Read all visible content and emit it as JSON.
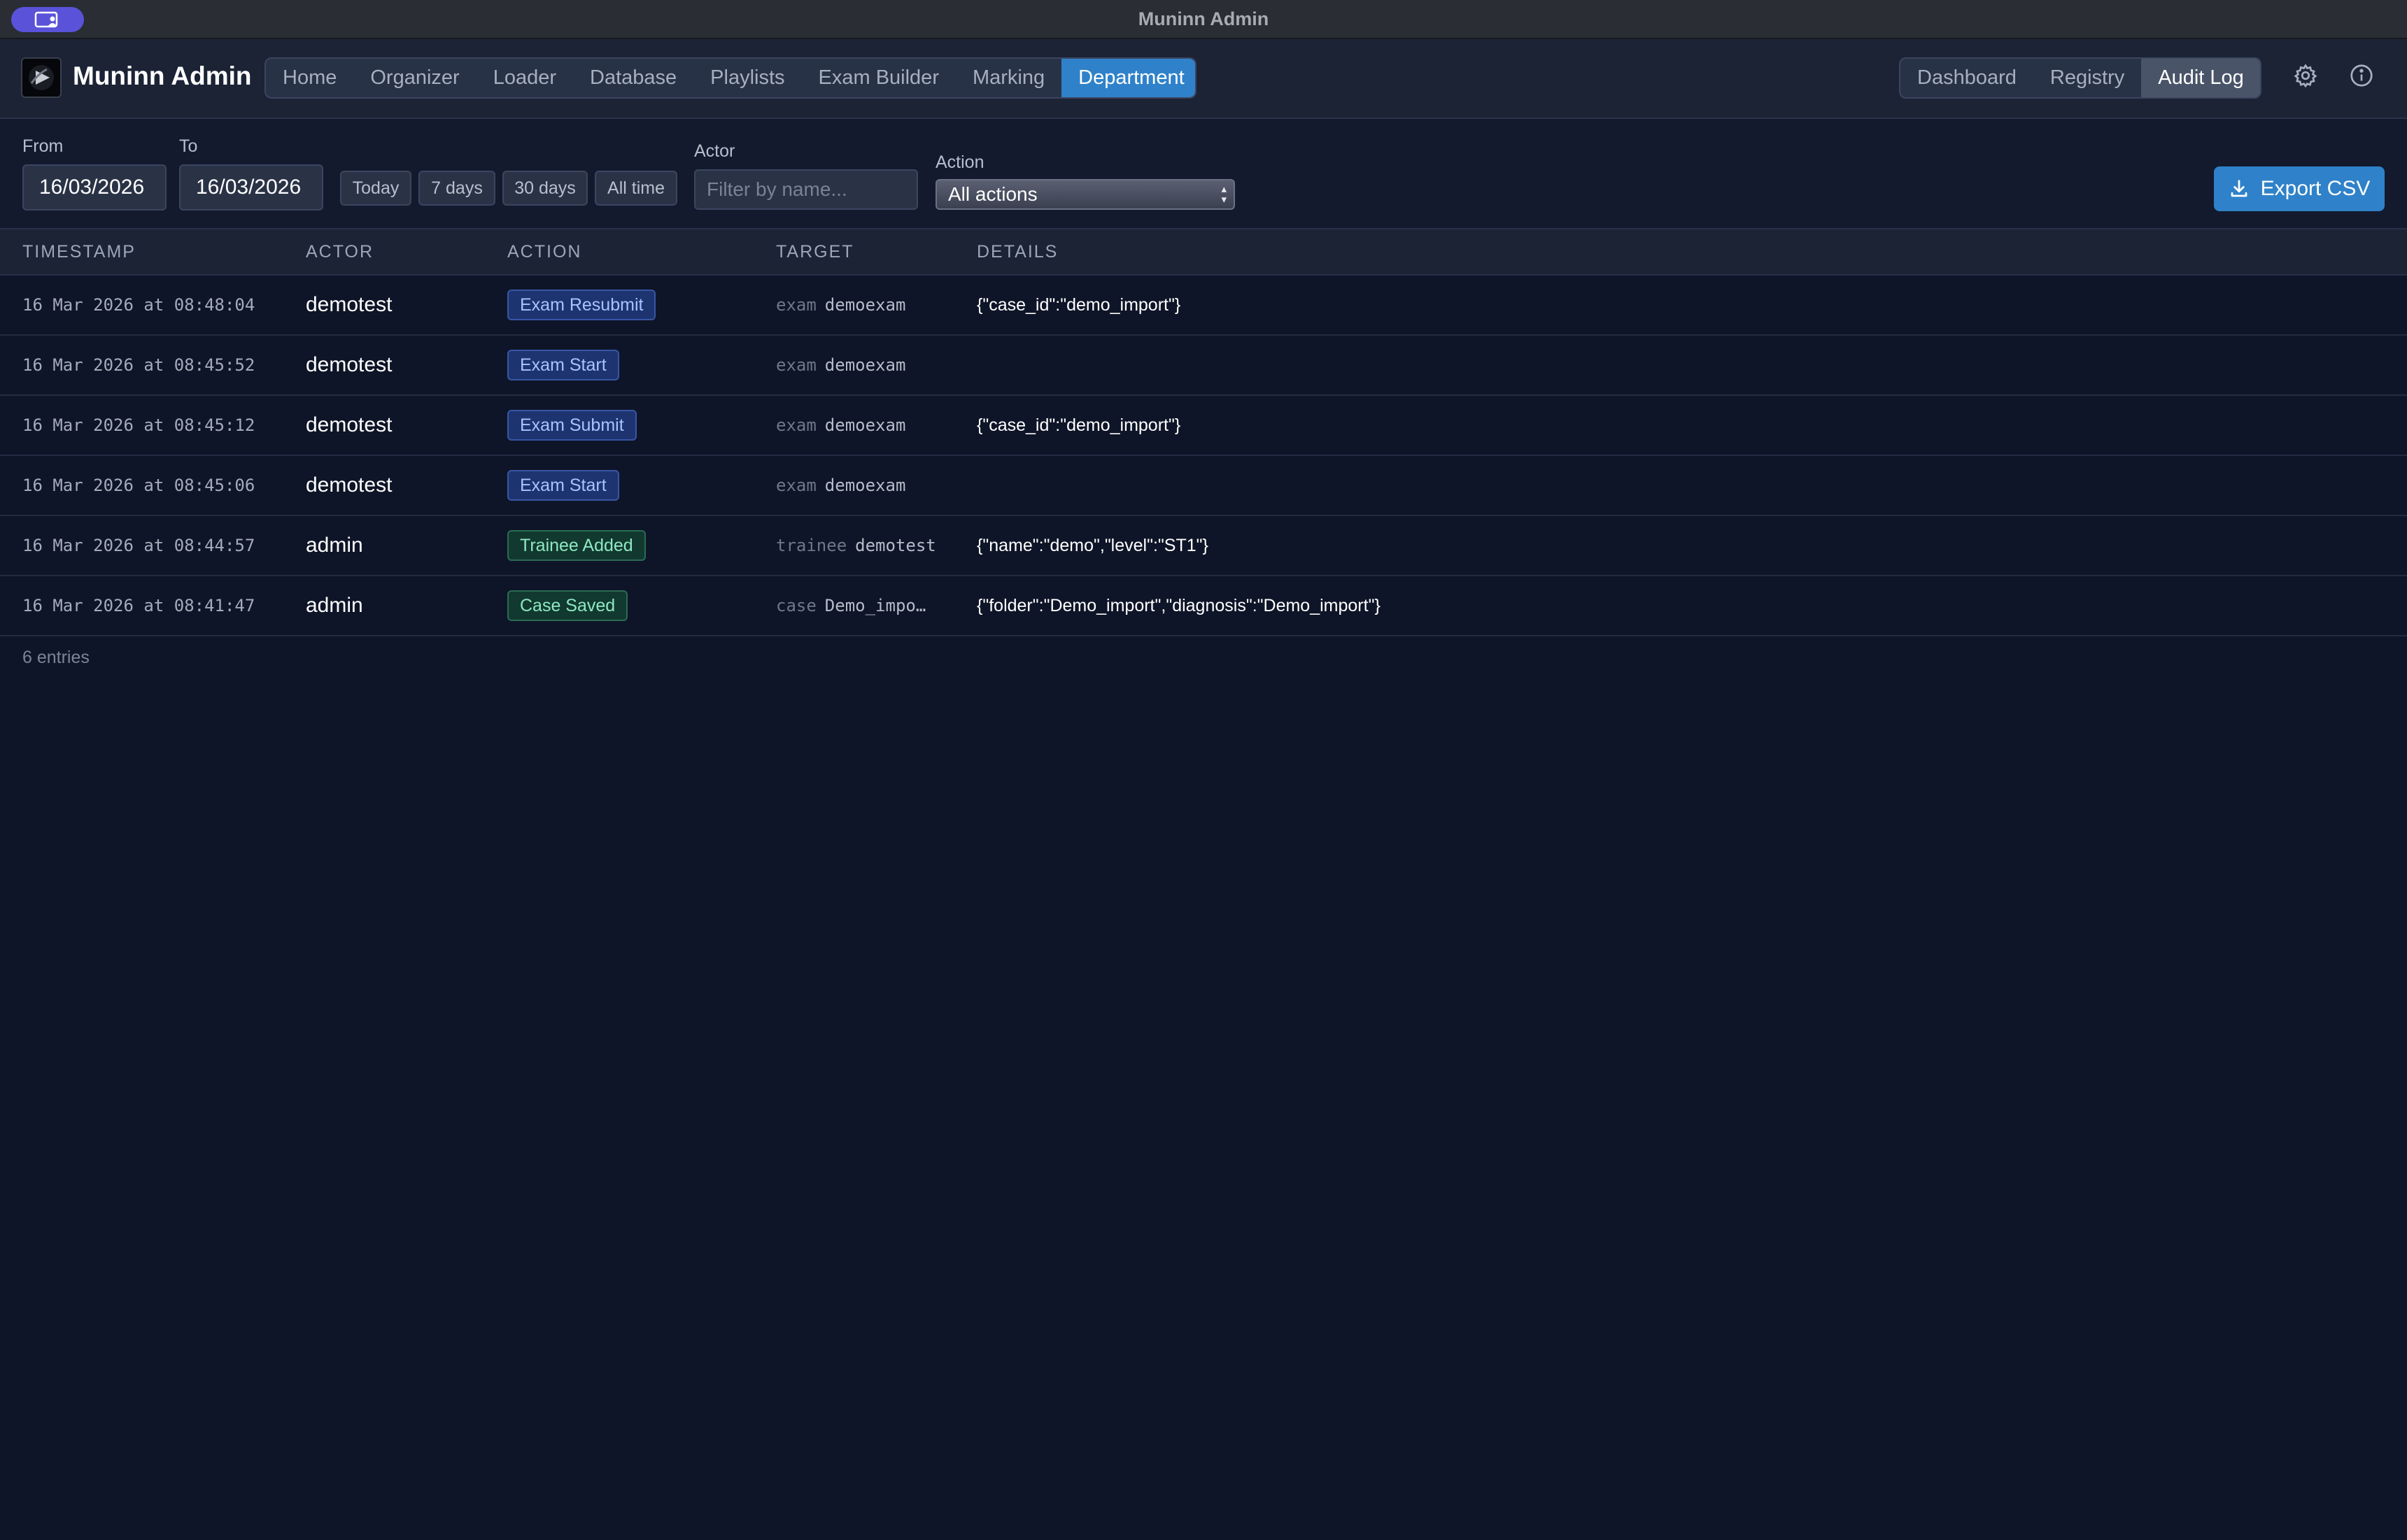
{
  "window": {
    "title": "Muninn Admin"
  },
  "brand": {
    "name": "Muninn Admin"
  },
  "nav": {
    "main": [
      {
        "label": "Home",
        "active": false
      },
      {
        "label": "Organizer",
        "active": false
      },
      {
        "label": "Loader",
        "active": false
      },
      {
        "label": "Database",
        "active": false
      },
      {
        "label": "Playlists",
        "active": false
      },
      {
        "label": "Exam Builder",
        "active": false
      },
      {
        "label": "Marking",
        "active": false
      },
      {
        "label": "Department",
        "active": true
      }
    ],
    "sub": [
      {
        "label": "Dashboard",
        "active": false
      },
      {
        "label": "Registry",
        "active": false
      },
      {
        "label": "Audit Log",
        "active": true
      }
    ],
    "icons": [
      "settings-gear-icon",
      "info-icon"
    ]
  },
  "filters": {
    "from_label": "From",
    "from_value": "16/03/2026",
    "to_label": "To",
    "to_value": "16/03/2026",
    "quick": [
      "Today",
      "7 days",
      "30 days",
      "All time"
    ],
    "actor_label": "Actor",
    "actor_placeholder": "Filter by name...",
    "action_label": "Action",
    "action_value": "All actions",
    "export_label": "Export CSV"
  },
  "table": {
    "columns": [
      "TIMESTAMP",
      "ACTOR",
      "ACTION",
      "TARGET",
      "DETAILS"
    ],
    "rows": [
      {
        "timestamp": "16 Mar 2026 at 08:48:04",
        "actor": "demotest",
        "action": "Exam Resubmit",
        "action_color": "blue",
        "target_type": "exam",
        "target_name": "demoexam",
        "details": "{\"case_id\":\"demo_import\"}"
      },
      {
        "timestamp": "16 Mar 2026 at 08:45:52",
        "actor": "demotest",
        "action": "Exam Start",
        "action_color": "blue",
        "target_type": "exam",
        "target_name": "demoexam",
        "details": ""
      },
      {
        "timestamp": "16 Mar 2026 at 08:45:12",
        "actor": "demotest",
        "action": "Exam Submit",
        "action_color": "blue",
        "target_type": "exam",
        "target_name": "demoexam",
        "details": "{\"case_id\":\"demo_import\"}"
      },
      {
        "timestamp": "16 Mar 2026 at 08:45:06",
        "actor": "demotest",
        "action": "Exam Start",
        "action_color": "blue",
        "target_type": "exam",
        "target_name": "demoexam",
        "details": ""
      },
      {
        "timestamp": "16 Mar 2026 at 08:44:57",
        "actor": "admin",
        "action": "Trainee Added",
        "action_color": "green",
        "target_type": "trainee",
        "target_name": "demotest",
        "details": "{\"name\":\"demo\",\"level\":\"ST1\"}"
      },
      {
        "timestamp": "16 Mar 2026 at 08:41:47",
        "actor": "admin",
        "action": "Case Saved",
        "action_color": "green",
        "target_type": "case",
        "target_name": "Demo_impo…",
        "details": "{\"folder\":\"Demo_import\",\"diagnosis\":\"Demo_import\"}"
      }
    ],
    "footer": "6 entries"
  },
  "colors": {
    "background": "#0f1528",
    "accent": "#2f82c9",
    "badge_blue": "#1e3470",
    "badge_green": "#12392f"
  }
}
